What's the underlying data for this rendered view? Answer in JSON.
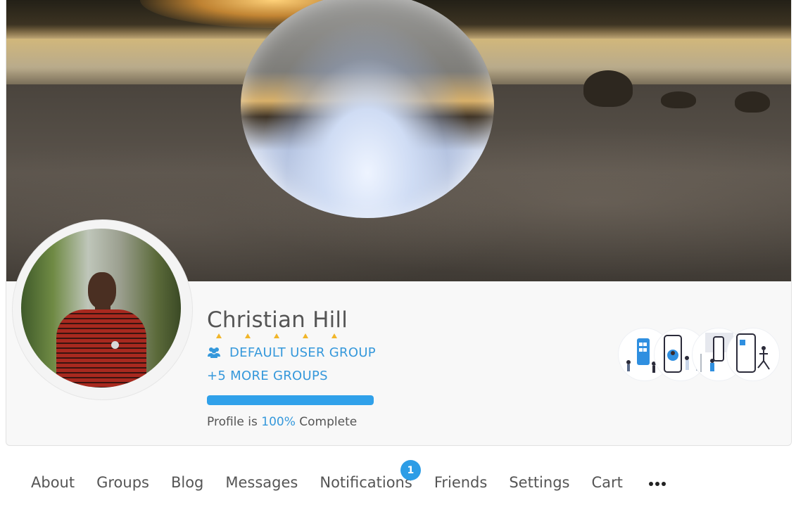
{
  "profile": {
    "name": "Christian Hill",
    "rating_stars": 5,
    "primary_group": "DEFAULT USER GROUP",
    "more_groups": "+5 MORE GROUPS",
    "completion": {
      "value": 100,
      "prefix": "Profile is ",
      "percent_label": "100%",
      "suffix": " Complete"
    },
    "achievement_badges": [
      "mobile-app-badge",
      "team-mobile-badge",
      "presentation-badge",
      "mobile-yoga-badge"
    ]
  },
  "nav": {
    "items": [
      {
        "label": "About"
      },
      {
        "label": "Groups"
      },
      {
        "label": "Blog"
      },
      {
        "label": "Messages"
      },
      {
        "label": "Notifications",
        "badge": "1"
      },
      {
        "label": "Friends"
      },
      {
        "label": "Settings"
      },
      {
        "label": "Cart"
      }
    ],
    "more_icon": "more-horizontal-icon"
  },
  "colors": {
    "accent": "#3598db",
    "progress": "#30a1ea",
    "badge": "#2d9de6",
    "star": "#f1b62a",
    "text": "#555555"
  }
}
